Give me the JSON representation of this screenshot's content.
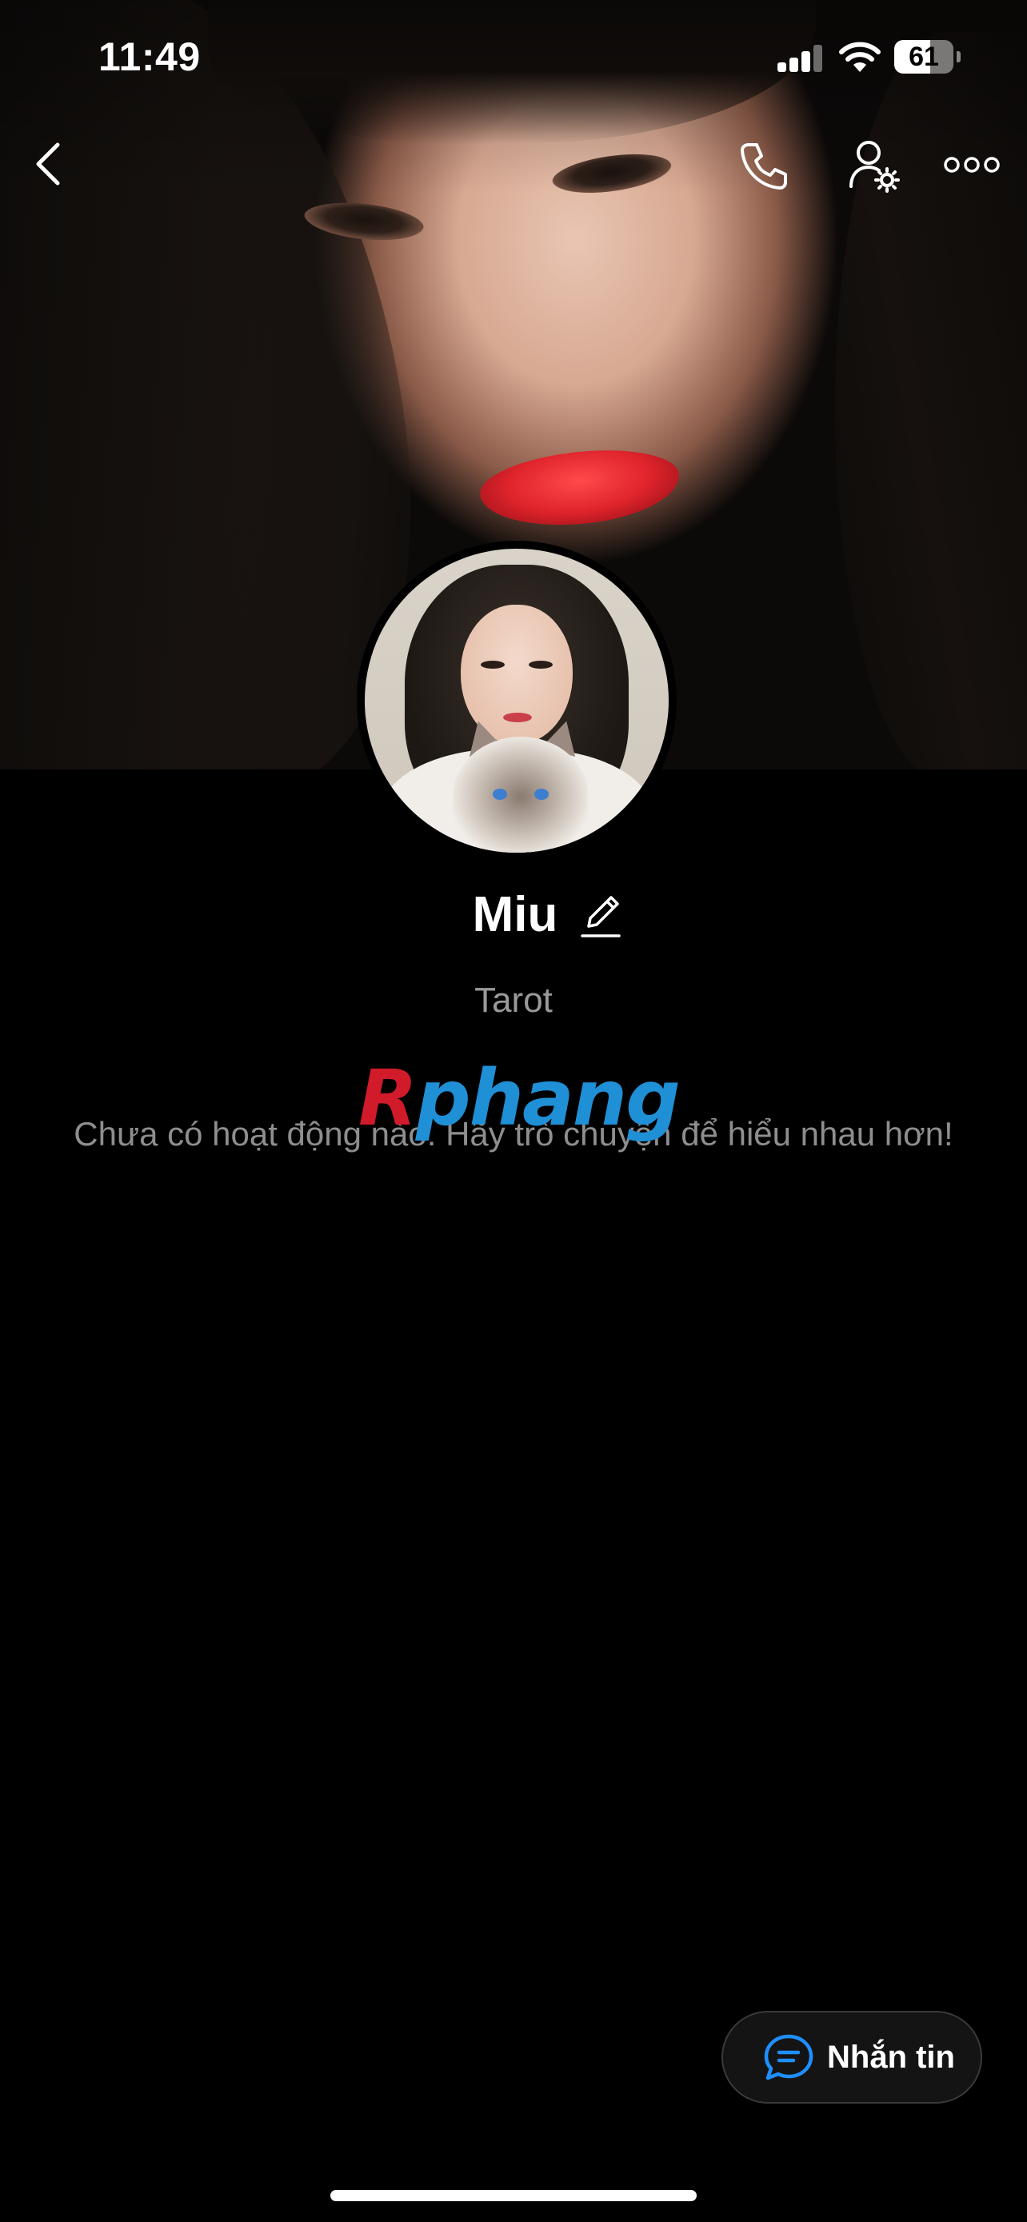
{
  "status_bar": {
    "time": "11:49",
    "battery_level": 61,
    "battery_text": "61"
  },
  "header": {
    "back_icon": "chevron-left-icon",
    "call_icon": "phone-icon",
    "profile_settings_icon": "user-gear-icon",
    "more_icon": "more-horizontal-icon"
  },
  "profile": {
    "name": "Miu",
    "edit_icon": "pencil-icon",
    "bio": "Tarot",
    "empty_activity_text": "Chưa có hoạt động nào. Hãy trò chuyện để hiểu nhau hơn!"
  },
  "watermark": {
    "part_a": "R",
    "part_b": "phang"
  },
  "actions": {
    "message_label": "Nhắn tin",
    "message_icon": "chat-bubble-icon"
  },
  "colors": {
    "background": "#000000",
    "message_icon_accent": "#1f8fff",
    "watermark_red": "#d11a2a",
    "watermark_blue": "#1f8fd6"
  }
}
